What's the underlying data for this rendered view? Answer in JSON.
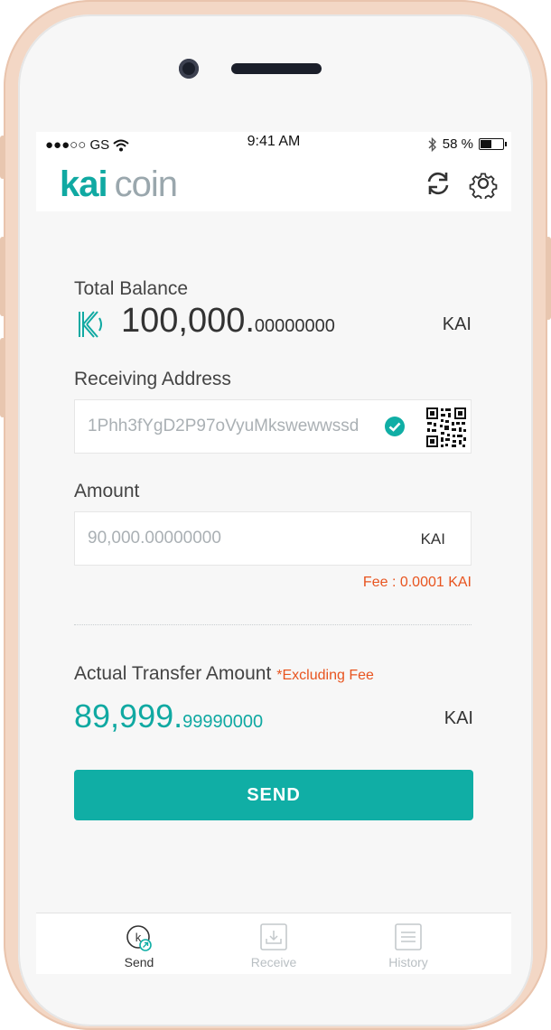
{
  "status_bar": {
    "carrier": "●●●○○ GS",
    "time": "9:41 AM",
    "battery": "58 %"
  },
  "header": {
    "logo_kai": "kai",
    "logo_coin": "coin",
    "refresh_icon": "refresh-icon",
    "settings_icon": "gear-icon"
  },
  "balance": {
    "label": "Total Balance",
    "integer": "100,000.",
    "decimal": "00000000",
    "unit": "KAI"
  },
  "address": {
    "label": "Receiving Address",
    "value": "1Phh3fYgD2P97oVyuMkswewwssd"
  },
  "amount": {
    "label": "Amount",
    "value": "90,000.00000000",
    "unit": "KAI",
    "fee": "Fee : 0.0001 KAI"
  },
  "transfer": {
    "label": "Actual Transfer Amount",
    "note": "*Excluding Fee",
    "integer": "89,999.",
    "decimal": "99990000",
    "unit": "KAI"
  },
  "send_button": "SEND",
  "tabs": [
    {
      "label": "Send",
      "active": true
    },
    {
      "label": "Receive",
      "active": false
    },
    {
      "label": "History",
      "active": false
    }
  ],
  "colors": {
    "accent": "#10aea5",
    "warning": "#e8541f",
    "frame": "#f3d7c5"
  }
}
